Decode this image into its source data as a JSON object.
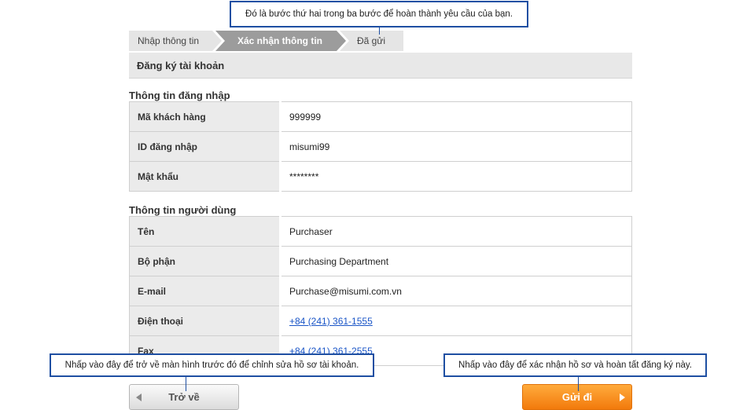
{
  "steps": {
    "step1": "Nhập thông tin",
    "step2": "Xác nhận thông tin",
    "step3": "Đã gửi"
  },
  "form_header": "Đăng ký tài khoản",
  "login_section": {
    "title": "Thông tin đăng nhập",
    "rows": [
      {
        "label": "Mã khách hàng",
        "value": "999999"
      },
      {
        "label": "ID đăng nhập",
        "value": "misumi99"
      },
      {
        "label": "Mật khẩu",
        "value": "********"
      }
    ]
  },
  "user_section": {
    "title": "Thông tin người dùng",
    "rows": [
      {
        "label": "Tên",
        "value": "Purchaser"
      },
      {
        "label": "Bộ phận",
        "value": "Purchasing Department"
      },
      {
        "label": "E-mail",
        "value": "Purchase@misumi.com.vn"
      },
      {
        "label": "Điện thoại",
        "value": "+84 (241) 361-1555"
      },
      {
        "label": "Fax",
        "value": "+84 (241) 361-2555"
      }
    ]
  },
  "callouts": {
    "step_tip": "Đó là bước thứ hai trong ba bước để hoàn thành yêu cầu của bạn.",
    "back_tip": "Nhấp vào đây để trở về màn hình trước đó để chỉnh sửa hồ sơ tài khoản.",
    "submit_tip": "Nhấp vào đây để xác nhận hồ sơ và hoàn tất đăng ký này."
  },
  "buttons": {
    "back": "Trở về",
    "submit": "Gửi đi"
  },
  "colors": {
    "active_step": "#9c9c9c",
    "callout_border": "#1e4fa2",
    "submit_button": "#f27a0c",
    "link": "#1a55c7"
  }
}
